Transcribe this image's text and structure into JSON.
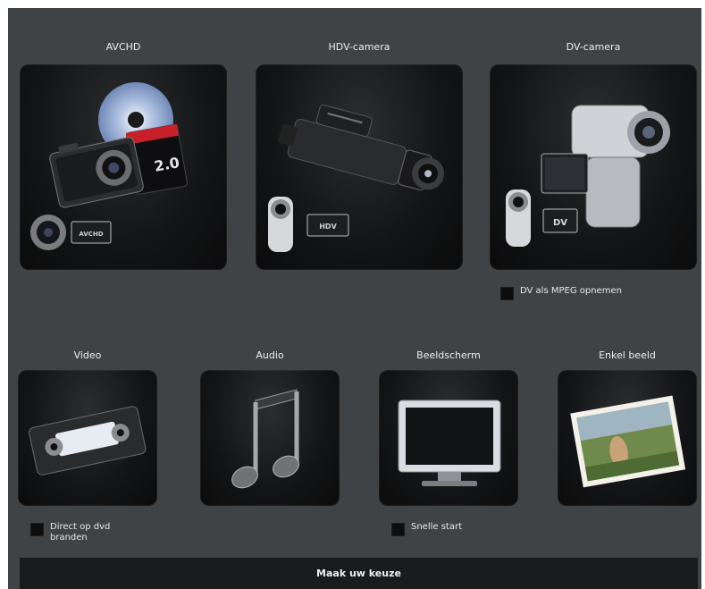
{
  "sources": {
    "avchd": "AVCHD",
    "hdv": "HDV-camera",
    "dv": "DV-camera",
    "video": "Video",
    "audio": "Audio",
    "screen": "Beeldscherm",
    "still": "Enkel beeld"
  },
  "tile_text": {
    "sd_card": "2.0",
    "avchd_badge": "AVCHD",
    "hdv_badge": "HDV",
    "dv_badge": "DV"
  },
  "options": {
    "dv_mpeg": "DV als MPEG opnemen",
    "burn_dvd": "Direct op dvd branden",
    "quick_start": "Snelle start"
  },
  "footer": {
    "choose": "Maak uw keuze"
  }
}
